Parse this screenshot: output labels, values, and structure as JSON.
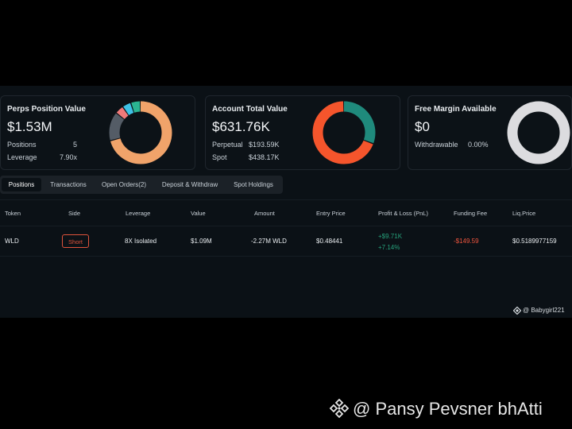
{
  "cards": {
    "perps": {
      "title": "Perps Position Value",
      "value": "$1.53M",
      "rows": [
        {
          "label": "Positions",
          "value": "5"
        },
        {
          "label": "Leverage",
          "value": "7.90x"
        }
      ],
      "donut": [
        {
          "fraction": 0.71,
          "color": "#f0a36a"
        },
        {
          "fraction": 0.15,
          "color": "#545c66"
        },
        {
          "fraction": 0.045,
          "color": "#f07a7a"
        },
        {
          "fraction": 0.045,
          "color": "#3fc2e6"
        },
        {
          "fraction": 0.05,
          "color": "#2bb592"
        }
      ]
    },
    "account": {
      "title": "Account Total Value",
      "value": "$631.76K",
      "rows": [
        {
          "label": "Perpetual",
          "value": "$193.59K"
        },
        {
          "label": "Spot",
          "value": "$438.17K"
        }
      ],
      "donut": [
        {
          "fraction": 0.31,
          "color": "#1f8a7c"
        },
        {
          "fraction": 0.69,
          "color": "#f5552c"
        }
      ]
    },
    "margin": {
      "title": "Free Margin Available",
      "value": "$0",
      "rows": [
        {
          "label": "Withdrawable",
          "value": "0.00%"
        }
      ],
      "donut": [
        {
          "fraction": 1.0,
          "color": "#dcdcdf"
        }
      ]
    }
  },
  "tabs": [
    {
      "label": "Positions",
      "active": true
    },
    {
      "label": "Transactions",
      "active": false
    },
    {
      "label": "Open Orders(2)",
      "active": false
    },
    {
      "label": "Deposit & Withdraw",
      "active": false
    },
    {
      "label": "Spot Holdings",
      "active": false
    }
  ],
  "table": {
    "headers": [
      "Token",
      "Side",
      "Leverage",
      "Value",
      "Amount",
      "Entry Price",
      "Profit & Loss (PnL)",
      "Funding Fee",
      "Liq.Price"
    ],
    "row": {
      "token": "WLD",
      "side": "Short",
      "leverage": "8X Isolated",
      "value": "$1.09M",
      "amount": "-2.27M WLD",
      "entry_price": "$0.48441",
      "pnl": "+$9.71K",
      "pnl_pct": "+7.14%",
      "funding_fee": "-$149.59",
      "liq_price": "$0.5189977159"
    }
  },
  "watermarks": {
    "small": "@ Babygirl221",
    "big": "@ Pansy Pevsner bhAtti"
  },
  "colors": {
    "positive": "#26a17b",
    "negative": "#f0553e",
    "short_badge": "#e0533c"
  }
}
